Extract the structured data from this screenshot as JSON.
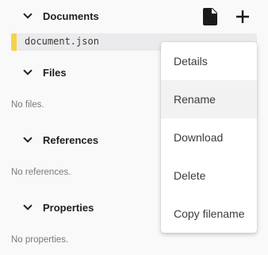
{
  "sections": {
    "documents": {
      "title": "Documents"
    },
    "files": {
      "title": "Files",
      "empty": "No files."
    },
    "references": {
      "title": "References",
      "empty": "No references."
    },
    "properties": {
      "title": "Properties",
      "empty": "No properties."
    }
  },
  "documents_list": [
    {
      "name": "document.json",
      "marker_color": "#f3d34a"
    }
  ],
  "toolbar": {
    "new_document_icon": "document-icon",
    "add_icon": "plus-icon"
  },
  "context_menu": {
    "items": [
      {
        "label": "Details"
      },
      {
        "label": "Rename",
        "highlighted": true
      },
      {
        "label": "Download"
      },
      {
        "label": "Delete"
      },
      {
        "label": "Copy filename"
      }
    ]
  }
}
